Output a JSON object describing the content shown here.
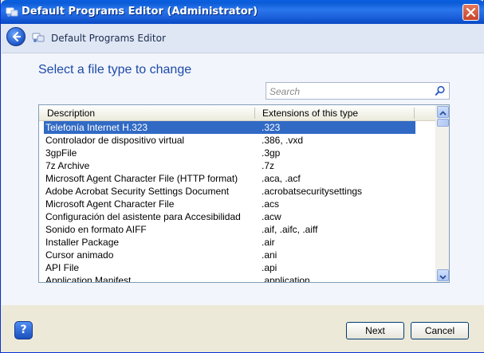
{
  "window": {
    "title": "Default Programs Editor (Administrator)",
    "icons": {
      "app": "default-programs-icon",
      "close": "close-icon"
    }
  },
  "nav": {
    "title": "Default Programs Editor",
    "icons": {
      "back": "back-arrow-icon",
      "app": "default-programs-icon"
    }
  },
  "main": {
    "heading": "Select a file type to change",
    "search": {
      "placeholder": "Search",
      "value": "",
      "icon": "search-icon"
    },
    "list": {
      "columns": [
        "Description",
        "Extensions of this type"
      ],
      "selected_index": 0,
      "rows": [
        {
          "description": "Telefonía Internet H.323",
          "extensions": ".323"
        },
        {
          "description": "Controlador de dispositivo virtual",
          "extensions": ".386, .vxd"
        },
        {
          "description": "3gpFile",
          "extensions": ".3gp"
        },
        {
          "description": "7z Archive",
          "extensions": ".7z"
        },
        {
          "description": "Microsoft Agent Character File (HTTP format)",
          "extensions": ".aca, .acf"
        },
        {
          "description": "Adobe Acrobat Security Settings Document",
          "extensions": ".acrobatsecuritysettings"
        },
        {
          "description": "Microsoft Agent Character File",
          "extensions": ".acs"
        },
        {
          "description": "Configuración del asistente para Accesibilidad",
          "extensions": ".acw"
        },
        {
          "description": "Sonido en formato AIFF",
          "extensions": ".aif, .aifc, .aiff"
        },
        {
          "description": "Installer Package",
          "extensions": ".air"
        },
        {
          "description": "Cursor animado",
          "extensions": ".ani"
        },
        {
          "description": "API File",
          "extensions": ".api"
        },
        {
          "description": "Application Manifest",
          "extensions": ".application"
        }
      ]
    }
  },
  "footer": {
    "help_icon": "help-icon",
    "help_label": "?",
    "next_label": "Next",
    "cancel_label": "Cancel"
  },
  "colors": {
    "title_bar": "#1d62dc",
    "heading": "#1d4aa8",
    "selection": "#316ac5"
  }
}
